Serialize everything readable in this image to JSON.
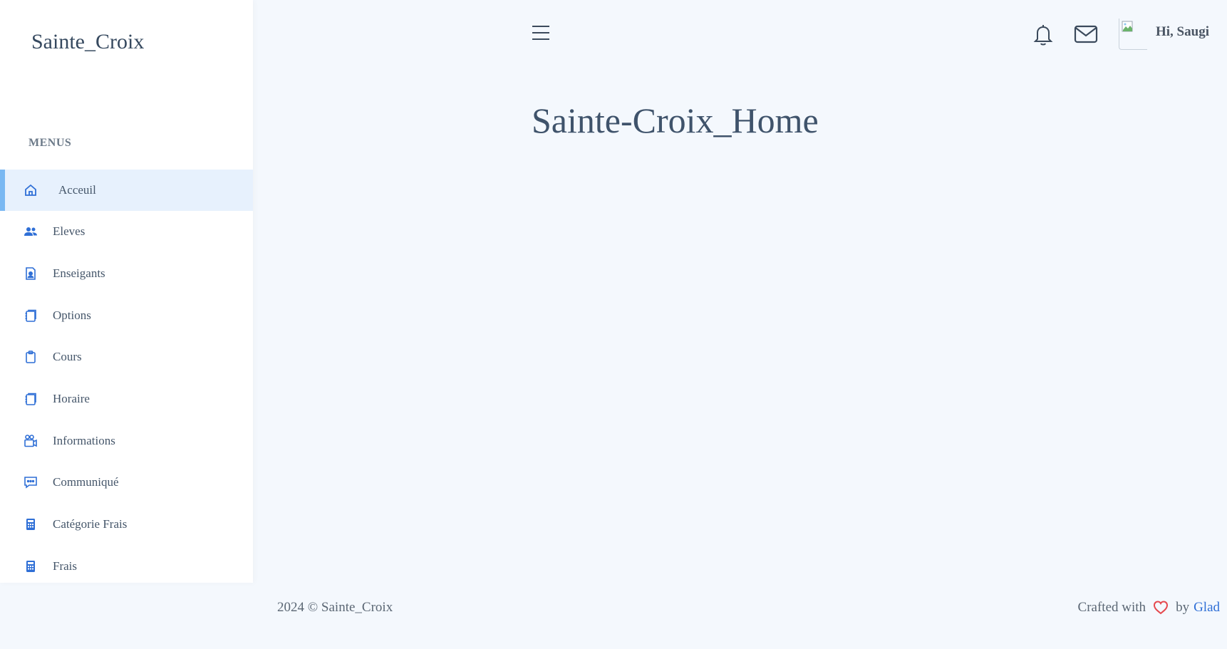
{
  "brand": "Sainte_Croix",
  "menu_title": "MENUS",
  "nav": [
    {
      "label": "Acceuil",
      "icon": "home-icon",
      "active": true
    },
    {
      "label": "Eleves",
      "icon": "users-icon"
    },
    {
      "label": "Enseigants",
      "icon": "contact-card-icon"
    },
    {
      "label": "Options",
      "icon": "notebook-icon"
    },
    {
      "label": "Cours",
      "icon": "clipboard-icon"
    },
    {
      "label": "Horaire",
      "icon": "notebook-icon"
    },
    {
      "label": "Informations",
      "icon": "camera-icon"
    },
    {
      "label": "Communiqué",
      "icon": "message-icon"
    },
    {
      "label": "Catégorie Frais",
      "icon": "calculator-icon"
    },
    {
      "label": "Frais",
      "icon": "calculator-icon"
    }
  ],
  "header": {
    "greeting": "Hi, Saugi"
  },
  "main": {
    "title": "Sainte-Croix_Home"
  },
  "footer": {
    "copyright": "2024 © Sainte_Croix",
    "crafted_prefix": "Crafted with",
    "crafted_by": "by",
    "author": "Glad"
  },
  "colors": {
    "accent": "#2f6fd6",
    "active_bg": "#e7f1fd",
    "active_bar": "#7ab8f2",
    "heart": "#e5484d"
  }
}
